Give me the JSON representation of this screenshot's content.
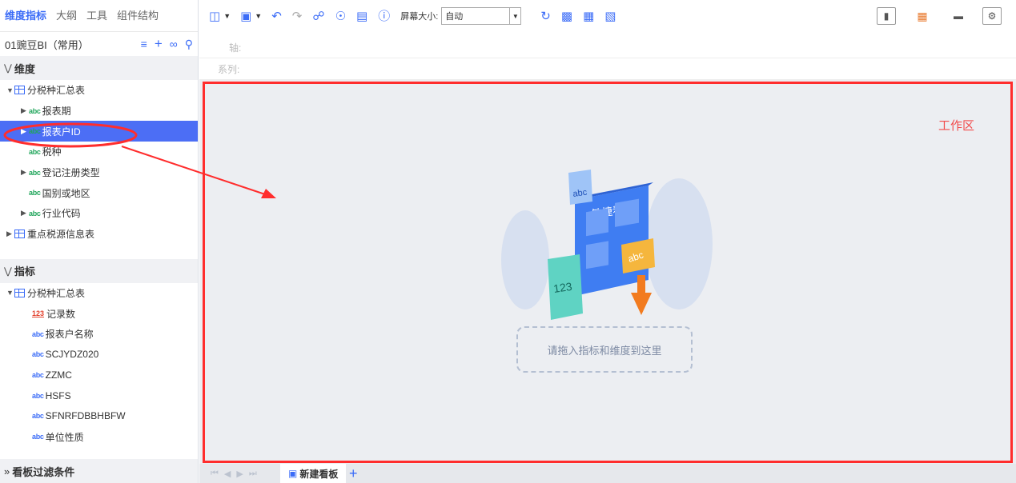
{
  "left_tabs": [
    "维度指标",
    "大纲",
    "工具",
    "组件结构"
  ],
  "package_name": "01豌豆BI（常用）",
  "dimensions": {
    "title": "维度",
    "table1": "分税种汇总表",
    "fields": [
      "报表期",
      "报表户ID",
      "税种",
      "登记注册类型",
      "国别或地区",
      "行业代码"
    ],
    "table2": "重点税源信息表"
  },
  "metrics": {
    "title": "指标",
    "table": "分税种汇总表",
    "fields": [
      "记录数",
      "报表户名称",
      "SCJYDZ020",
      "ZZMC",
      "HSFS",
      "SFNRFDBBHBFW",
      "单位性质"
    ]
  },
  "filter_title": "看板过滤条件",
  "abc_icon": "abc",
  "num_icon": "123",
  "toolbar": {
    "screen_size_label": "屏幕大小:",
    "screen_size_value": "自动"
  },
  "axis_label": "轴:",
  "series_label": "系列:",
  "workspace": {
    "label": "工作区",
    "illustration_title": "敏捷看板",
    "drop_hint": "请拖入指标和维度到这里"
  },
  "sheet_tab": "新建看板",
  "colors": {
    "accent": "#3b6cf7",
    "selected_row": "#4c6ef5",
    "annotation_red": "#ff2d2d"
  }
}
